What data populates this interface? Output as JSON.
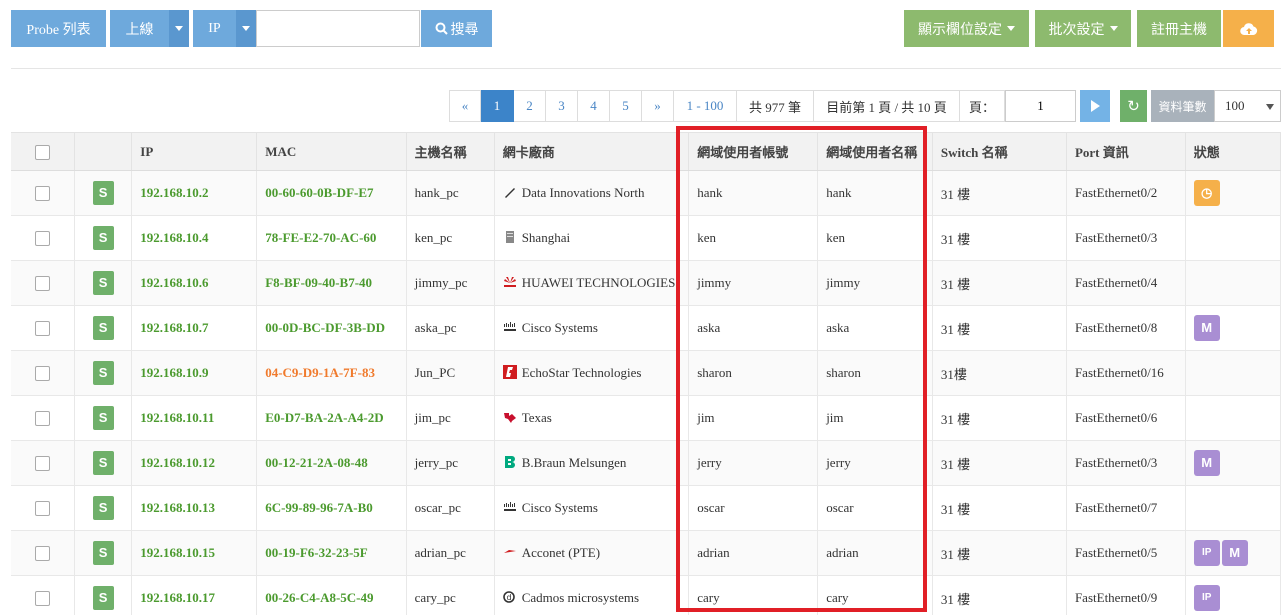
{
  "toolbar": {
    "probe_list": "Probe 列表",
    "online": "上線",
    "ip": "IP",
    "search_placeholder": "",
    "search": "搜尋",
    "display_columns": "顯示欄位設定",
    "batch_settings": "批次設定",
    "register_host": "註冊主機"
  },
  "pagination": {
    "prev": "«",
    "pages": [
      "1",
      "2",
      "3",
      "4",
      "5"
    ],
    "active_page": "1",
    "next": "»",
    "range": "1 - 100",
    "total": "共 977 筆",
    "current": "目前第 1 頁 / 共 10 頁",
    "page_label": "頁：",
    "page_value": "1",
    "count_label": "資料筆數",
    "count_value": "100"
  },
  "table": {
    "headers": {
      "ip": "IP",
      "mac": "MAC",
      "hostname": "主機名稱",
      "vendor": "網卡廠商",
      "domain_account": "網域使用者帳號",
      "domain_name": "網域使用者名稱",
      "switch": "Switch 名稱",
      "port": "Port 資訊",
      "status": "狀態"
    },
    "badge": "S",
    "rows": [
      {
        "ip": "192.168.10.2",
        "mac": "00-60-60-0B-DF-E7",
        "host": "hank_pc",
        "vendor": "Data Innovations North",
        "account": "hank",
        "name": "hank",
        "switch": "31 樓",
        "port": "FastEthernet0/2"
      },
      {
        "ip": "192.168.10.4",
        "mac": "78-FE-E2-70-AC-60",
        "host": "ken_pc",
        "vendor": "Shanghai",
        "account": "ken",
        "name": "ken",
        "switch": "31 樓",
        "port": "FastEthernet0/3"
      },
      {
        "ip": "192.168.10.6",
        "mac": "F8-BF-09-40-B7-40",
        "host": "jimmy_pc",
        "vendor": "HUAWEI TECHNOLOGIES",
        "account": "jimmy",
        "name": "jimmy",
        "switch": "31 樓",
        "port": "FastEthernet0/4"
      },
      {
        "ip": "192.168.10.7",
        "mac": "00-0D-BC-DF-3B-DD",
        "host": "aska_pc",
        "vendor": "Cisco Systems",
        "account": "aska",
        "name": "aska",
        "switch": "31 樓",
        "port": "FastEthernet0/8"
      },
      {
        "ip": "192.168.10.9",
        "mac": "04-C9-D9-1A-7F-83",
        "host": "Jun_PC",
        "vendor": "EchoStar Technologies",
        "account": "sharon",
        "name": "sharon",
        "switch": "31樓",
        "port": "FastEthernet0/16"
      },
      {
        "ip": "192.168.10.11",
        "mac": "E0-D7-BA-2A-A4-2D",
        "host": "jim_pc",
        "vendor": "Texas",
        "account": "jim",
        "name": "jim",
        "switch": "31 樓",
        "port": "FastEthernet0/6"
      },
      {
        "ip": "192.168.10.12",
        "mac": "00-12-21-2A-08-48",
        "host": "jerry_pc",
        "vendor": "B.Braun Melsungen",
        "account": "jerry",
        "name": "jerry",
        "switch": "31 樓",
        "port": "FastEthernet0/3"
      },
      {
        "ip": "192.168.10.13",
        "mac": "6C-99-89-96-7A-B0",
        "host": "oscar_pc",
        "vendor": "Cisco Systems",
        "account": "oscar",
        "name": "oscar",
        "switch": "31 樓",
        "port": "FastEthernet0/7"
      },
      {
        "ip": "192.168.10.15",
        "mac": "00-19-F6-32-23-5F",
        "host": "adrian_pc",
        "vendor": "Acconet (PTE)",
        "account": "adrian",
        "name": "adrian",
        "switch": "31 樓",
        "port": "FastEthernet0/5"
      },
      {
        "ip": "192.168.10.17",
        "mac": "00-26-C4-A8-5C-49",
        "host": "cary_pc",
        "vendor": "Cadmos microsystems",
        "account": "cary",
        "name": "cary",
        "switch": "31 樓",
        "port": "FastEthernet0/9"
      }
    ]
  },
  "colors": {
    "ip_green": "#4b9a2e",
    "mac_warning": "#f07a2c",
    "highlight": "#e11f26",
    "status_timer": "#f5b04a",
    "status_purple": "#a98ed3"
  }
}
